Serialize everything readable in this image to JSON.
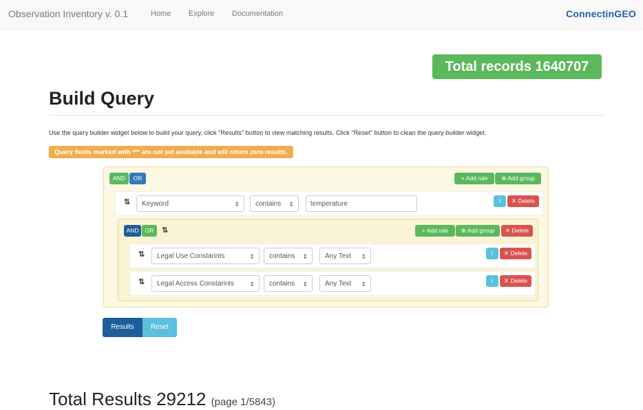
{
  "navbar": {
    "brand": "Observation Inventory v. 0.1",
    "links": [
      "Home",
      "Explore",
      "Documentation"
    ],
    "logo_text": "ConnectinGEO"
  },
  "total_records": "Total records 1640707",
  "title": "Build Query",
  "intro": "Use the query builder widget below to build your query, click \"Results\" button to view matching results. Click \"Reset\" button to clean the query builder widget.",
  "warning": "Query fields marked with *** are not yet available and will return zero results.",
  "query_builder": {
    "and_label": "AND",
    "or_label": "OR",
    "add_rule_label": "Add rule",
    "add_group_label": "Add group",
    "delete_label": "Delete",
    "rule1": {
      "field": "Keyword",
      "operator": "contains",
      "value": "temperature"
    },
    "subgroup": {
      "rules": [
        {
          "field": "Legal Use Constarints",
          "operator": "contains",
          "value": "Any Text"
        },
        {
          "field": "Legal Access Constarints",
          "operator": "contains",
          "value": "Any Text"
        }
      ]
    }
  },
  "results_button": "Results",
  "reset_button": "Reset",
  "total_results": "Total Results 29212",
  "page_info": "(page 1/5843)",
  "colors": {
    "green": "#5cb85c",
    "blue": "#337ab7",
    "red": "#d9534f",
    "info": "#5bc0de",
    "warning": "#f0ad4e"
  }
}
